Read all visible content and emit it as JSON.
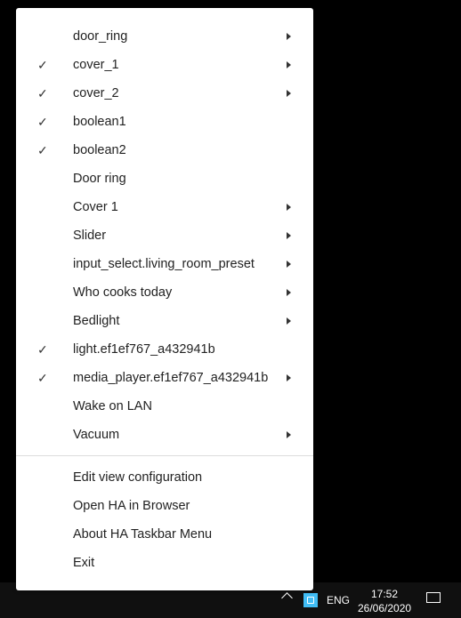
{
  "menu": {
    "items": [
      {
        "label": "door_ring",
        "checked": false,
        "submenu": true
      },
      {
        "label": "cover_1",
        "checked": true,
        "submenu": true
      },
      {
        "label": "cover_2",
        "checked": true,
        "submenu": true
      },
      {
        "label": "boolean1",
        "checked": true,
        "submenu": false
      },
      {
        "label": "boolean2",
        "checked": true,
        "submenu": false
      },
      {
        "label": "Door ring",
        "checked": false,
        "submenu": false
      },
      {
        "label": "Cover 1",
        "checked": false,
        "submenu": true
      },
      {
        "label": "Slider",
        "checked": false,
        "submenu": true
      },
      {
        "label": "input_select.living_room_preset",
        "checked": false,
        "submenu": true
      },
      {
        "label": "Who cooks today",
        "checked": false,
        "submenu": true
      },
      {
        "label": "Bedlight",
        "checked": false,
        "submenu": true
      },
      {
        "label": "light.ef1ef767_a432941b",
        "checked": true,
        "submenu": false
      },
      {
        "label": "media_player.ef1ef767_a432941b",
        "checked": true,
        "submenu": true
      },
      {
        "label": "Wake on LAN",
        "checked": false,
        "submenu": false
      },
      {
        "label": "Vacuum",
        "checked": false,
        "submenu": true
      }
    ],
    "actions": [
      {
        "label": "Edit view configuration"
      },
      {
        "label": "Open HA in Browser"
      },
      {
        "label": "About HA Taskbar Menu"
      },
      {
        "label": "Exit"
      }
    ],
    "check_glyph": "✓"
  },
  "taskbar": {
    "language": "ENG",
    "time": "17:52",
    "date": "26/06/2020",
    "ha_icon_color": "#41bdf5"
  }
}
